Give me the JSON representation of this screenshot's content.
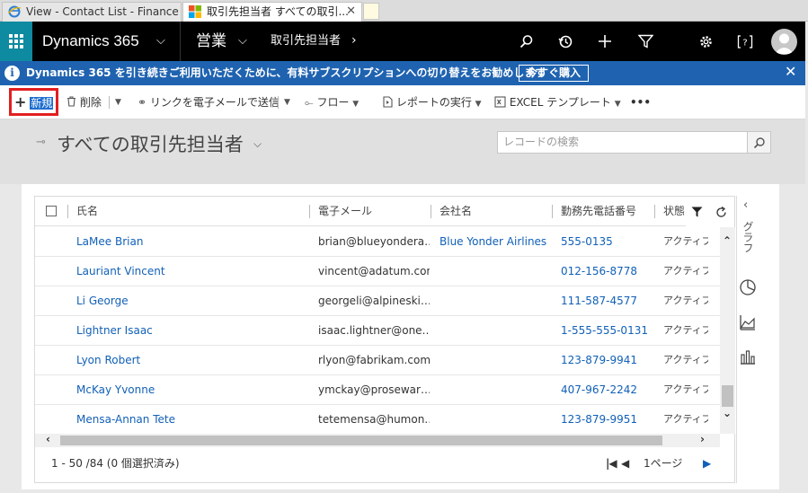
{
  "browser": {
    "tabs": [
      {
        "title": "View - Contact List - Finance a..."
      },
      {
        "title": "取引先担当者 すべての取引..."
      }
    ]
  },
  "nav": {
    "brand": "Dynamics 365",
    "area": "営業",
    "entity": "取引先担当者"
  },
  "notification": {
    "text": "Dynamics 365 を引き続きご利用いただくために、有料サブスクリプションへの切り替えをお勧めします",
    "button": "今すぐ購入"
  },
  "commands": {
    "new": "新規",
    "delete": "削除",
    "email_link": "リンクを電子メールで送信",
    "flow": "フロー",
    "run_report": "レポートの実行",
    "excel_template": "EXCEL テンプレート",
    "more": "•••"
  },
  "view": {
    "title": "すべての取引先担当者",
    "search_placeholder": "レコードの検索"
  },
  "grid": {
    "columns": {
      "name": "氏名",
      "email": "電子メール",
      "company": "会社名",
      "phone": "勤務先電話番号",
      "status": "状態"
    },
    "rows": [
      {
        "name": "LaMee Brian",
        "email": "brian@blueyondera…",
        "company": "Blue Yonder Airlines",
        "phone": "555-0135",
        "status": "アクティブ"
      },
      {
        "name": "Lauriant Vincent",
        "email": "vincent@adatum.com",
        "company": "",
        "phone": "012-156-8778",
        "status": "アクティブ"
      },
      {
        "name": "Li George",
        "email": "georgeli@alpineski…",
        "company": "",
        "phone": "111-587-4577",
        "status": "アクティブ"
      },
      {
        "name": "Lightner Isaac",
        "email": "isaac.lightner@one…",
        "company": "",
        "phone": "1-555-555-0131",
        "status": "アクティブ"
      },
      {
        "name": "Lyon Robert",
        "email": "rlyon@fabrikam.com",
        "company": "",
        "phone": "123-879-9941",
        "status": "アクティブ"
      },
      {
        "name": "McKay Yvonne",
        "email": "ymckay@prosewar…",
        "company": "",
        "phone": "407-967-2242",
        "status": "アクティブ"
      },
      {
        "name": "Mensa-Annan Tete",
        "email": "tetemensa@humon…",
        "company": "",
        "phone": "123-879-9951",
        "status": "アクティブ"
      }
    ],
    "record_count": "1 - 50 /84 (0 個選択済み)",
    "page_label": "1ページ"
  },
  "side_panel": {
    "label": "グラフ"
  },
  "colors": {
    "accent": "#0e8aa1",
    "notification": "#1f63b0",
    "link": "#1160b7"
  }
}
